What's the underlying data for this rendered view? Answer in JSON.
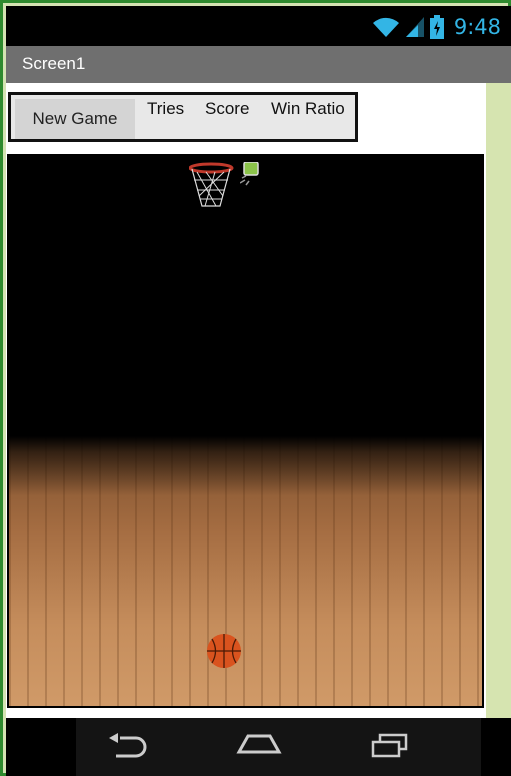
{
  "status_bar": {
    "time": "9:48",
    "icons": [
      "wifi-icon",
      "signal-icon",
      "battery-charging-icon"
    ],
    "accent_color": "#33b5e5"
  },
  "title_bar": {
    "title": "Screen1",
    "background": "#6f6f6f"
  },
  "controls": {
    "new_game_label": "New Game",
    "tries_label": "Tries",
    "score_label": "Score",
    "win_ratio_label": "Win Ratio"
  },
  "game": {
    "sprites": [
      "basketball-hoop",
      "flag-marker",
      "basketball"
    ],
    "background": "black-arena-with-wood-floor"
  },
  "nav_bar": {
    "buttons": [
      "back-icon",
      "home-icon",
      "recent-apps-icon"
    ]
  }
}
